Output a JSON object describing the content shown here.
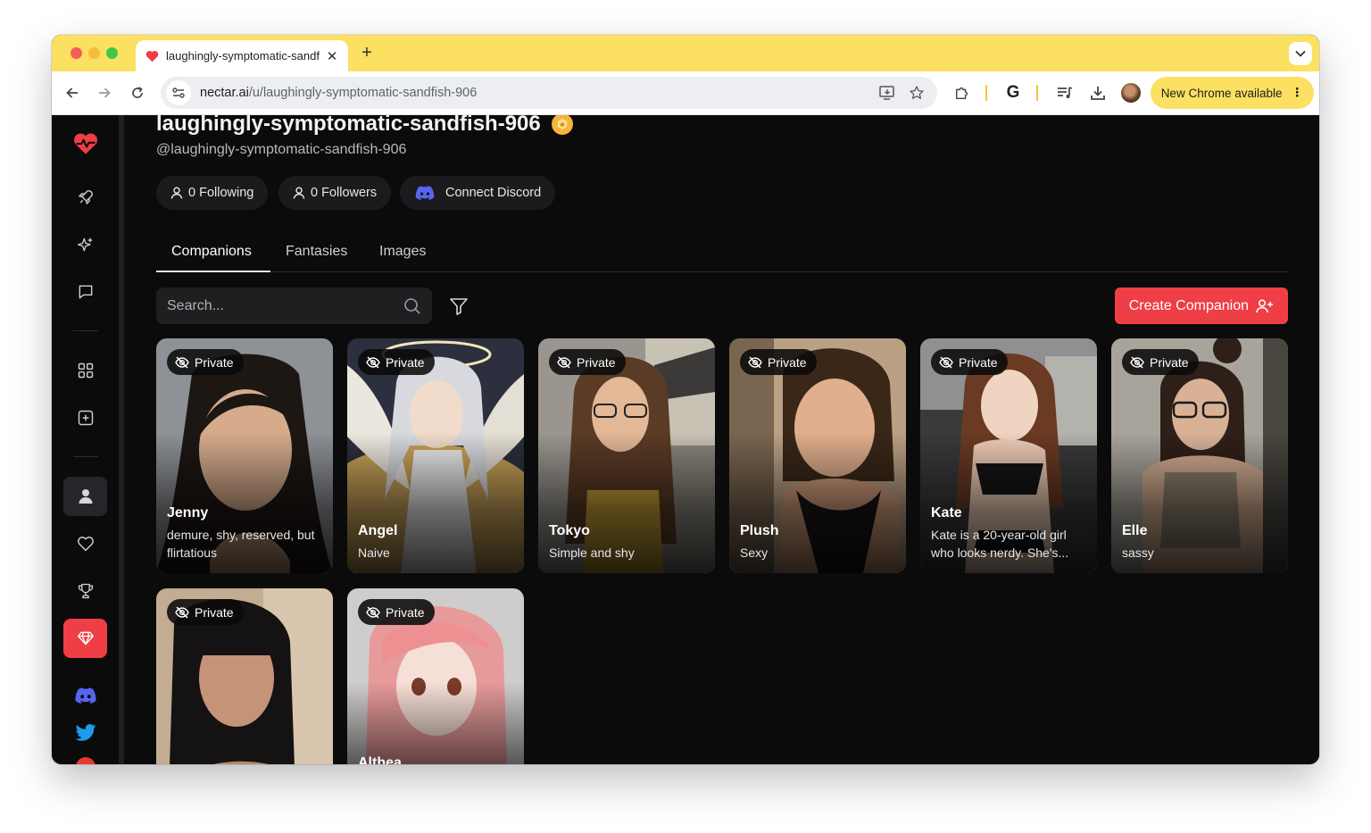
{
  "browser": {
    "tab_title": "laughingly-symptomatic-sandfish-906",
    "url_host": "nectar.ai",
    "url_path": "/u/laughingly-symptomatic-sandfish-906",
    "update_label": "New Chrome available"
  },
  "profile": {
    "username": "laughingly-symptomatic-sandfish-906",
    "handle": "@laughingly-symptomatic-sandfish-906",
    "following_label": "0 Following",
    "followers_label": "0 Followers",
    "discord_label": "Connect Discord"
  },
  "tabs": [
    "Companions",
    "Fantasies",
    "Images"
  ],
  "search": {
    "placeholder": "Search..."
  },
  "create_button_label": "Create Companion",
  "private_label": "Private",
  "companions": [
    {
      "name": "Jenny",
      "desc": "demure, shy, reserved, but flirtatious"
    },
    {
      "name": "Angel",
      "desc": "Naive"
    },
    {
      "name": "Tokyo",
      "desc": "Simple and shy"
    },
    {
      "name": "Plush",
      "desc": "Sexy"
    },
    {
      "name": "Kate",
      "desc": "Kate is a 20-year-old girl who looks nerdy. She's..."
    },
    {
      "name": "Elle",
      "desc": "sassy"
    },
    {
      "name": "",
      "desc": ""
    },
    {
      "name": "Althea",
      "desc": ""
    }
  ],
  "colors": {
    "accent": "#ef3e45",
    "chrome_yellow": "#fbe062",
    "bg": "#0b0b0c",
    "discord": "#5865f2"
  }
}
